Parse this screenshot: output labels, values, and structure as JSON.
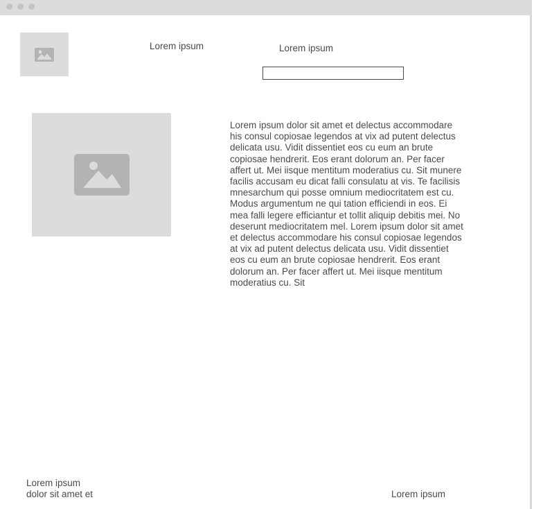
{
  "window": {
    "controls": [
      "window-dot",
      "window-dot",
      "window-dot"
    ]
  },
  "header": {
    "logo_icon": "image-placeholder-icon",
    "nav_label_1": "Lorem ipsum",
    "search_label": "Lorem ipsum",
    "search_value": ""
  },
  "main": {
    "hero_image_icon": "image-placeholder-icon",
    "body_text": "Lorem ipsum dolor sit amet et delectus accommodare his consul copiosae legendos at vix ad putent delectus delicata usu. Vidit dissentiet eos cu eum an brute copiosae hendrerit. Eos erant dolorum an. Per facer affert ut. Mei iisque mentitum moderatius cu. Sit munere facilis accusam eu dicat falli consulatu at vis. Te facilisis mnesarchum qui posse omnium mediocritatem est cu. Modus argumentum ne qui tation efficiendi in eos. Ei mea falli legere efficiantur et tollit aliquip debitis mei. No deserunt mediocritatem mel. Lorem ipsum dolor sit amet et delectus accommodare his consul copiosae legendos at vix ad putent delectus delicata usu. Vidit dissentiet eos cu eum an brute copiosae hendrerit. Eos erant dolorum an. Per facer affert ut. Mei iisque mentitum moderatius cu. Sit"
  },
  "footer": {
    "left_line_1": "Lorem ipsum",
    "left_line_2": "dolor sit amet et",
    "right_label": "Lorem ipsum"
  },
  "colors": {
    "titlebar": "#dcdcdc",
    "placeholder": "#dcdcdc",
    "placeholder_glyph": "#b3b3b3",
    "text": "#4a4a4a"
  }
}
